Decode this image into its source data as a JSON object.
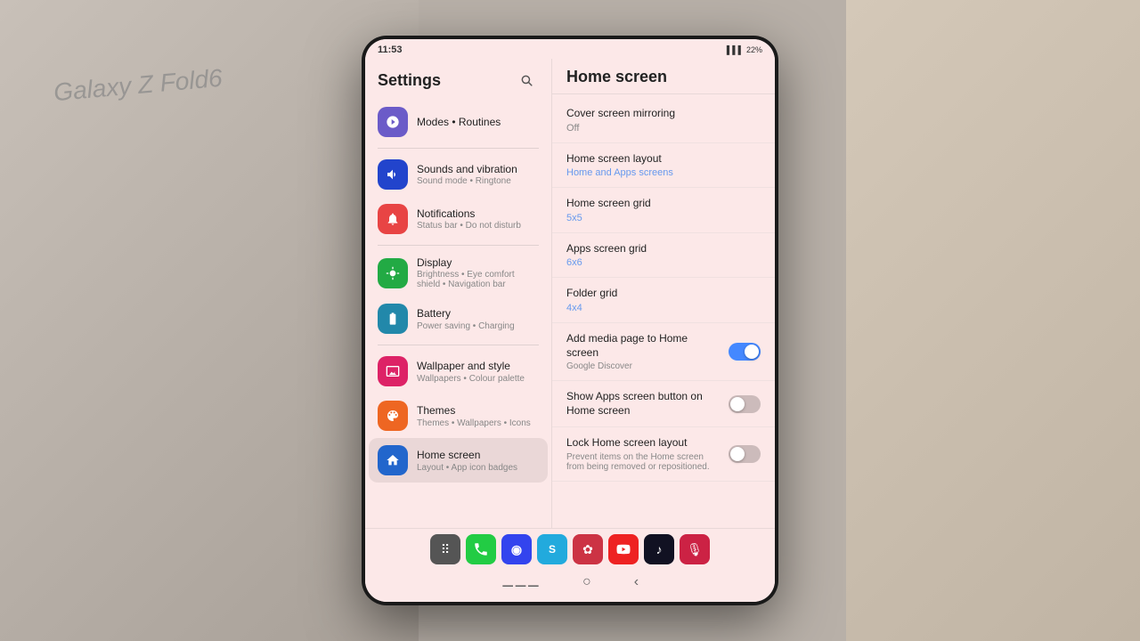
{
  "background": {
    "device_label": "Galaxy Z Fold6"
  },
  "status_bar": {
    "time": "11:53",
    "battery": "22%",
    "signal": "▌▌▌"
  },
  "settings_panel": {
    "title": "Settings",
    "search_icon": "🔍",
    "items": [
      {
        "id": "modes",
        "icon": "🔄",
        "icon_class": "icon-purple",
        "icon_emoji": "⚙",
        "name": "Modes • Routines",
        "sub": ""
      },
      {
        "id": "sounds",
        "icon": "🔊",
        "icon_class": "icon-blue-dark",
        "icon_emoji": "🔊",
        "name": "Sounds and vibration",
        "sub": "Sound mode • Ringtone"
      },
      {
        "id": "notifications",
        "icon": "🔔",
        "icon_class": "icon-red-orange",
        "icon_emoji": "🔔",
        "name": "Notifications",
        "sub": "Status bar • Do not disturb"
      },
      {
        "id": "display",
        "icon": "☀",
        "icon_class": "icon-green",
        "icon_emoji": "☀",
        "name": "Display",
        "sub": "Brightness • Eye comfort shield • Navigation bar"
      },
      {
        "id": "battery",
        "icon": "🔋",
        "icon_class": "icon-green-dark",
        "icon_emoji": "🔋",
        "name": "Battery",
        "sub": "Power saving • Charging"
      },
      {
        "id": "wallpaper",
        "icon": "🎨",
        "icon_class": "icon-pink",
        "icon_emoji": "🎨",
        "name": "Wallpaper and style",
        "sub": "Wallpapers • Colour palette"
      },
      {
        "id": "themes",
        "icon": "🖼",
        "icon_class": "icon-orange",
        "icon_emoji": "🖼",
        "name": "Themes",
        "sub": "Themes • Wallpapers • Icons"
      },
      {
        "id": "homescreen",
        "icon": "🏠",
        "icon_class": "icon-blue",
        "icon_emoji": "🏠",
        "name": "Home screen",
        "sub": "Layout • App icon badges"
      }
    ]
  },
  "home_panel": {
    "title": "Home screen",
    "items": [
      {
        "id": "cover-screen",
        "name": "Cover screen mirroring",
        "value": "Off",
        "type": "link"
      },
      {
        "id": "home-layout",
        "name": "Home screen layout",
        "value": "Home and Apps screens",
        "type": "link"
      },
      {
        "id": "home-grid",
        "name": "Home screen grid",
        "value": "5x5",
        "type": "link"
      },
      {
        "id": "apps-grid",
        "name": "Apps screen grid",
        "value": "6x6",
        "type": "link"
      },
      {
        "id": "folder-grid",
        "name": "Folder grid",
        "value": "4x4",
        "type": "link"
      },
      {
        "id": "media-page",
        "name": "Add media page to Home screen",
        "sub": "Google Discover",
        "type": "toggle",
        "toggle_on": true
      },
      {
        "id": "show-apps-btn",
        "name": "Show Apps screen button on Home screen",
        "sub": "",
        "type": "toggle",
        "toggle_on": false
      },
      {
        "id": "lock-layout",
        "name": "Lock Home screen layout",
        "sub": "Prevent items on the Home screen from being removed or repositioned.",
        "type": "toggle",
        "toggle_on": false
      }
    ]
  },
  "dock_apps": [
    {
      "id": "apps-grid",
      "emoji": "⠿",
      "bg": "#555",
      "label": "apps grid"
    },
    {
      "id": "phone",
      "emoji": "📞",
      "bg": "#22cc44",
      "label": "phone"
    },
    {
      "id": "bixby",
      "emoji": "◉",
      "bg": "#3344ee",
      "label": "bixby"
    },
    {
      "id": "samsung-health",
      "emoji": "S",
      "bg": "#22aadd",
      "label": "samsung health"
    },
    {
      "id": "klover",
      "emoji": "✿",
      "bg": "#cc3344",
      "label": "klover"
    },
    {
      "id": "youtube",
      "emoji": "▶",
      "bg": "#ee2222",
      "label": "youtube"
    },
    {
      "id": "tiktok",
      "emoji": "♪",
      "bg": "#111122",
      "label": "tiktok"
    },
    {
      "id": "podcast",
      "emoji": "🎙",
      "bg": "#cc2244",
      "label": "podcast"
    }
  ],
  "nav_buttons": {
    "recents": "⚊⚊⚊",
    "home": "○",
    "back": "‹"
  }
}
